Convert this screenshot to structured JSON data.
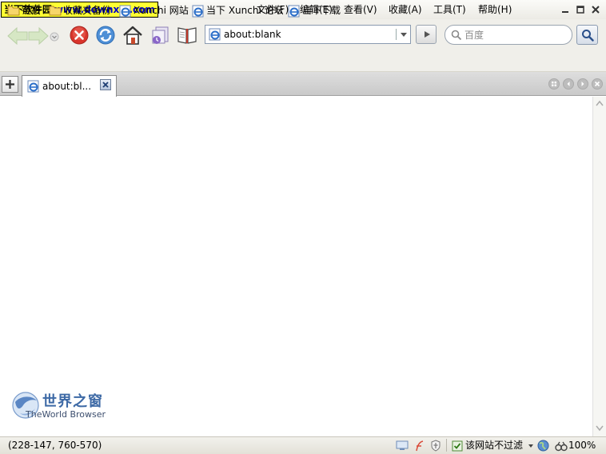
{
  "watermark": {
    "text_cn": "当下软件园",
    "text_url": "www.downxia.com"
  },
  "menu": {
    "file": "文件(F)",
    "edit": "编辑(E)",
    "view": "查看(V)",
    "favorites": "收藏(A)",
    "tools": "工具(T)",
    "help": "帮助(H)"
  },
  "address": {
    "url": "about:blank"
  },
  "search": {
    "placeholder": "百度"
  },
  "bookmarks": [
    {
      "label": "链接",
      "icon": "folder-icon"
    },
    {
      "label": "收藏夹备份",
      "icon": "folder-icon"
    },
    {
      "label": "Xunchi 网站",
      "icon": "ie-page-icon"
    },
    {
      "label": "当下 Xunchi 论坛",
      "icon": "ie-page-icon"
    },
    {
      "label": "当下下载",
      "icon": "ie-page-icon"
    }
  ],
  "tabs": [
    {
      "label": "about:bl...",
      "active": true
    }
  ],
  "logo": {
    "title": "世界之窗",
    "subtitle": "TheWorld Browser"
  },
  "status": {
    "coordinates": "(228-147, 760-570)",
    "filter_label": "该网站不过滤",
    "zoom": "100%"
  },
  "colors": {
    "accent_blue": "#3e6aa6",
    "stop_red": "#d9342b",
    "watermark_yellow": "#ffff33",
    "bar_bg": "#f0efea"
  }
}
